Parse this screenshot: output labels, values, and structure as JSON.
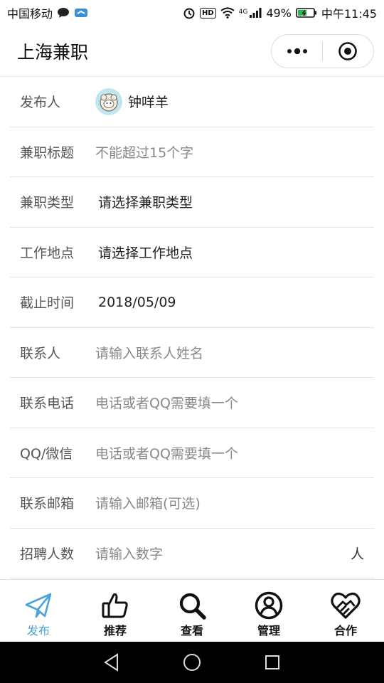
{
  "status_bar": {
    "carrier": "中国移动",
    "battery": "49%",
    "time": "中午11:45",
    "hd": "HD",
    "network": "4G"
  },
  "header": {
    "title": "上海兼职"
  },
  "form": {
    "publisher": {
      "label": "发布人",
      "name": "钟咩羊"
    },
    "rows": [
      {
        "label": "兼职标题",
        "value": "不能超过15个字"
      },
      {
        "label": "兼职类型",
        "value": "请选择兼职类型"
      },
      {
        "label": "工作地点",
        "value": "请选择工作地点"
      },
      {
        "label": "截止时间",
        "value": "2018/05/09"
      },
      {
        "label": "联系人",
        "value": "请输入联系人姓名"
      },
      {
        "label": "联系电话",
        "value": "电话或者QQ需要填一个"
      },
      {
        "label": "QQ/微信",
        "value": "电话或者QQ需要填一个"
      },
      {
        "label": "联系邮箱",
        "value": "请输入邮箱(可选)"
      },
      {
        "label": "招聘人数",
        "value": "请输入数字",
        "unit": "人"
      }
    ]
  },
  "tabs": [
    {
      "label": "发布",
      "icon": "paper-plane-icon",
      "active": true
    },
    {
      "label": "推荐",
      "icon": "thumbs-up-icon"
    },
    {
      "label": "查看",
      "icon": "search-icon"
    },
    {
      "label": "管理",
      "icon": "user-circle-icon"
    },
    {
      "label": "合作",
      "icon": "handshake-heart-icon"
    }
  ],
  "colors": {
    "active_tab": "#4aa3d9",
    "text": "#333333",
    "placeholder": "#888888",
    "divider": "#e3e3e3"
  }
}
